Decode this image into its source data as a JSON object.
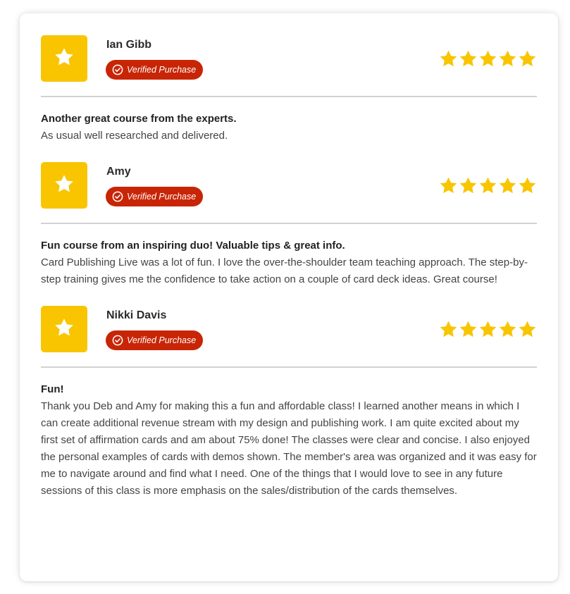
{
  "reviews": [
    {
      "name": "Ian Gibb",
      "badge": "Verified Purchase",
      "rating": 5,
      "title": "Another great course from the experts.",
      "text": "As usual well researched and delivered."
    },
    {
      "name": "Amy",
      "badge": "Verified Purchase",
      "rating": 5,
      "title": "Fun course from an inspiring duo! Valuable tips & great info.",
      "text": "Card Publishing Live was a lot of fun. I love the over-the-shoulder team teaching approach. The step-by-step training gives me the confidence to take action on a couple of card deck ideas. Great course!"
    },
    {
      "name": "Nikki Davis",
      "badge": "Verified Purchase",
      "rating": 5,
      "title": "Fun!",
      "text": "Thank you Deb and Amy for making this a fun and affordable class! I learned another means in which I can create additional revenue stream with my design and publishing work. I am quite excited about my first set of affirmation cards and am about 75% done! The classes were clear and concise. I also enjoyed the personal examples of cards with demos shown. The member's area was organized and it was easy for me to navigate around and find what I need. One of the things that I would love to see in any future sessions of this class is more emphasis on the sales/distribution of the cards themselves."
    }
  ],
  "icons": {
    "avatar": "star-icon",
    "badge": "check-circle-icon",
    "rating": "star-icon"
  },
  "colors": {
    "avatar_bg": "#f8c500",
    "badge_bg": "#c82506",
    "star": "#f8c500",
    "divider": "#d2d2d2"
  }
}
